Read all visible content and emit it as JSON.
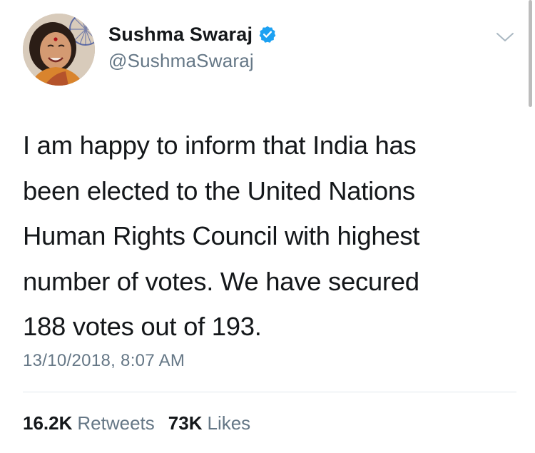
{
  "profile": {
    "name": "Sushma Swaraj",
    "handle": "@SushmaSwaraj",
    "avatar_icon": "profile-photo",
    "verified_icon": "verified-badge-icon",
    "verified_color": "#1da1f2"
  },
  "menu": {
    "icon": "chevron-down-icon"
  },
  "tweet": {
    "lines": [
      "I am happy to inform that India has",
      "been elected to the United Nations",
      "Human Rights Council with highest",
      "number of votes. We have secured",
      "188 votes out of 193."
    ],
    "timestamp": "13/10/2018, 8:07 AM"
  },
  "stats": {
    "retweets_count": "16.2K",
    "retweets_label": "Retweets",
    "likes_count": "73K",
    "likes_label": "Likes"
  },
  "colors": {
    "text": "#14171a",
    "secondary": "#657786",
    "divider": "#e1e8ed"
  }
}
